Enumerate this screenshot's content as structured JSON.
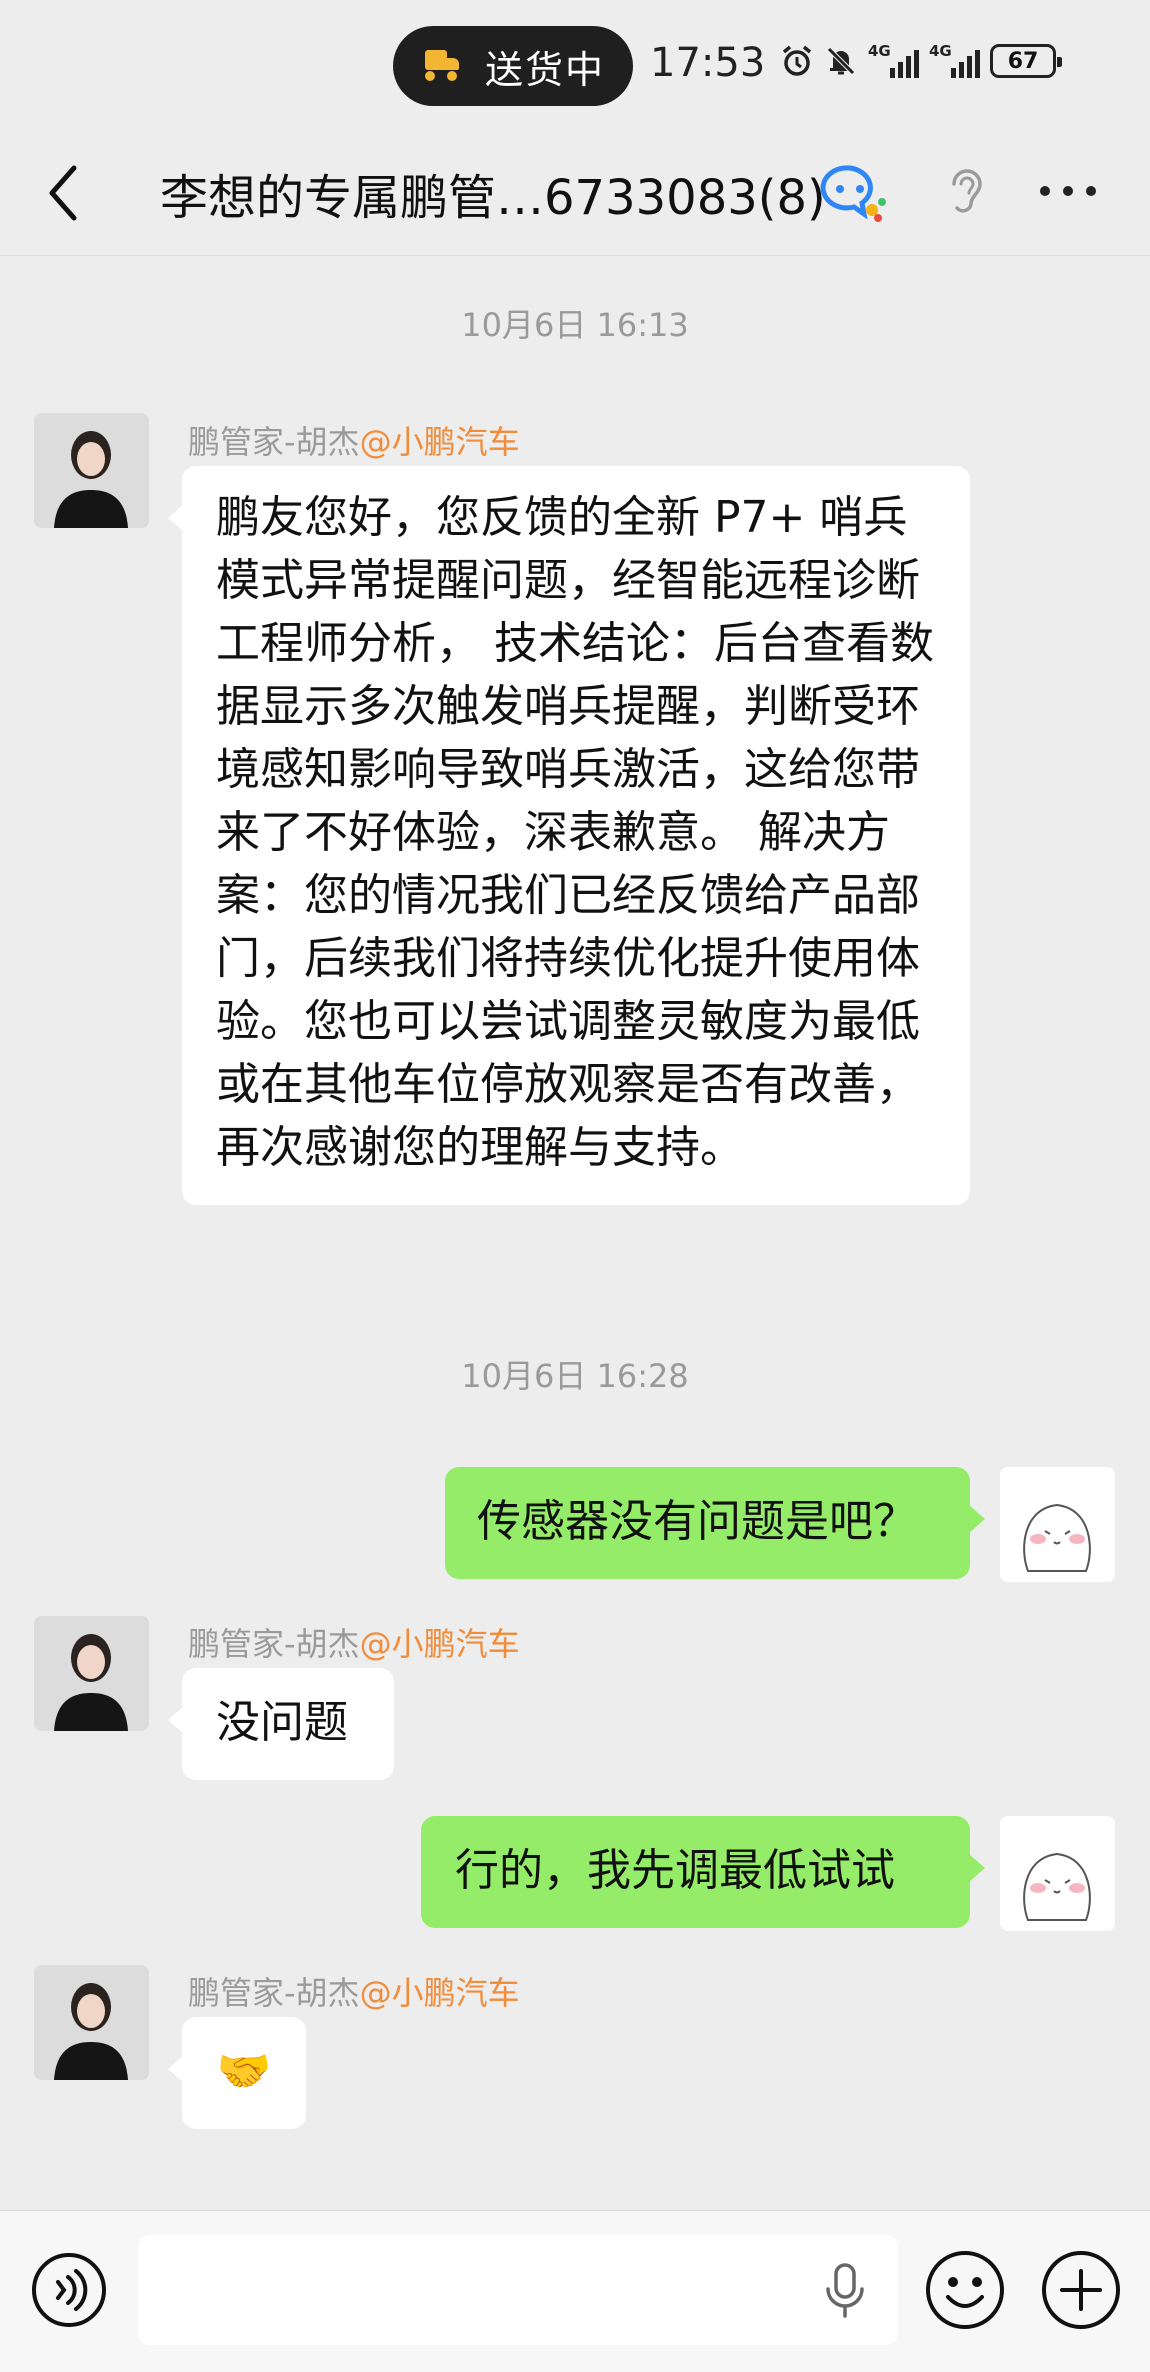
{
  "status_bar": {
    "delivery_pill": "送货中",
    "time": "17:53",
    "network_1": "4G",
    "network_2": "4G",
    "battery": "67"
  },
  "header": {
    "title": "李想的专属鹏管…6733083(8)",
    "icons": [
      "back-icon",
      "group-chat-icon",
      "ear-icon",
      "more-icon"
    ]
  },
  "messages": [
    {
      "type": "timestamp",
      "text": "10月6日 16:13"
    },
    {
      "type": "incoming",
      "sender_name": "鹏管家-胡杰",
      "sender_org": "@小鹏汽车",
      "text": "鹏友您好，您反馈的全新 P7+ 哨兵模式异常提醒问题，经智能远程诊断工程师分析， 技术结论：后台查看数据显示多次触发哨兵提醒，判断受环境感知影响导致哨兵激活，这给您带来了不好体验，深表歉意。 解决方案：您的情况我们已经反馈给产品部门，后续我们将持续优化提升使用体验。您也可以尝试调整灵敏度为最低或在其他车位停放观察是否有改善，再次感谢您的理解与支持。"
    },
    {
      "type": "timestamp",
      "text": "10月6日 16:28"
    },
    {
      "type": "outgoing",
      "text": "传感器没有问题是吧？"
    },
    {
      "type": "incoming",
      "sender_name": "鹏管家-胡杰",
      "sender_org": "@小鹏汽车",
      "text": "没问题"
    },
    {
      "type": "outgoing",
      "text": "行的，我先调最低试试"
    },
    {
      "type": "incoming",
      "sender_name": "鹏管家-胡杰",
      "sender_org": "@小鹏汽车",
      "text": "🤝"
    }
  ],
  "input_bar": {
    "placeholder": "",
    "icons": [
      "voice-icon",
      "microphone-icon",
      "emoji-icon",
      "plus-icon"
    ]
  },
  "colors": {
    "background": "#ededed",
    "outgoing_bubble": "#95ec69",
    "incoming_bubble": "#ffffff",
    "sender_org": "#f08c3a",
    "timestamp": "#9a9a9a"
  }
}
